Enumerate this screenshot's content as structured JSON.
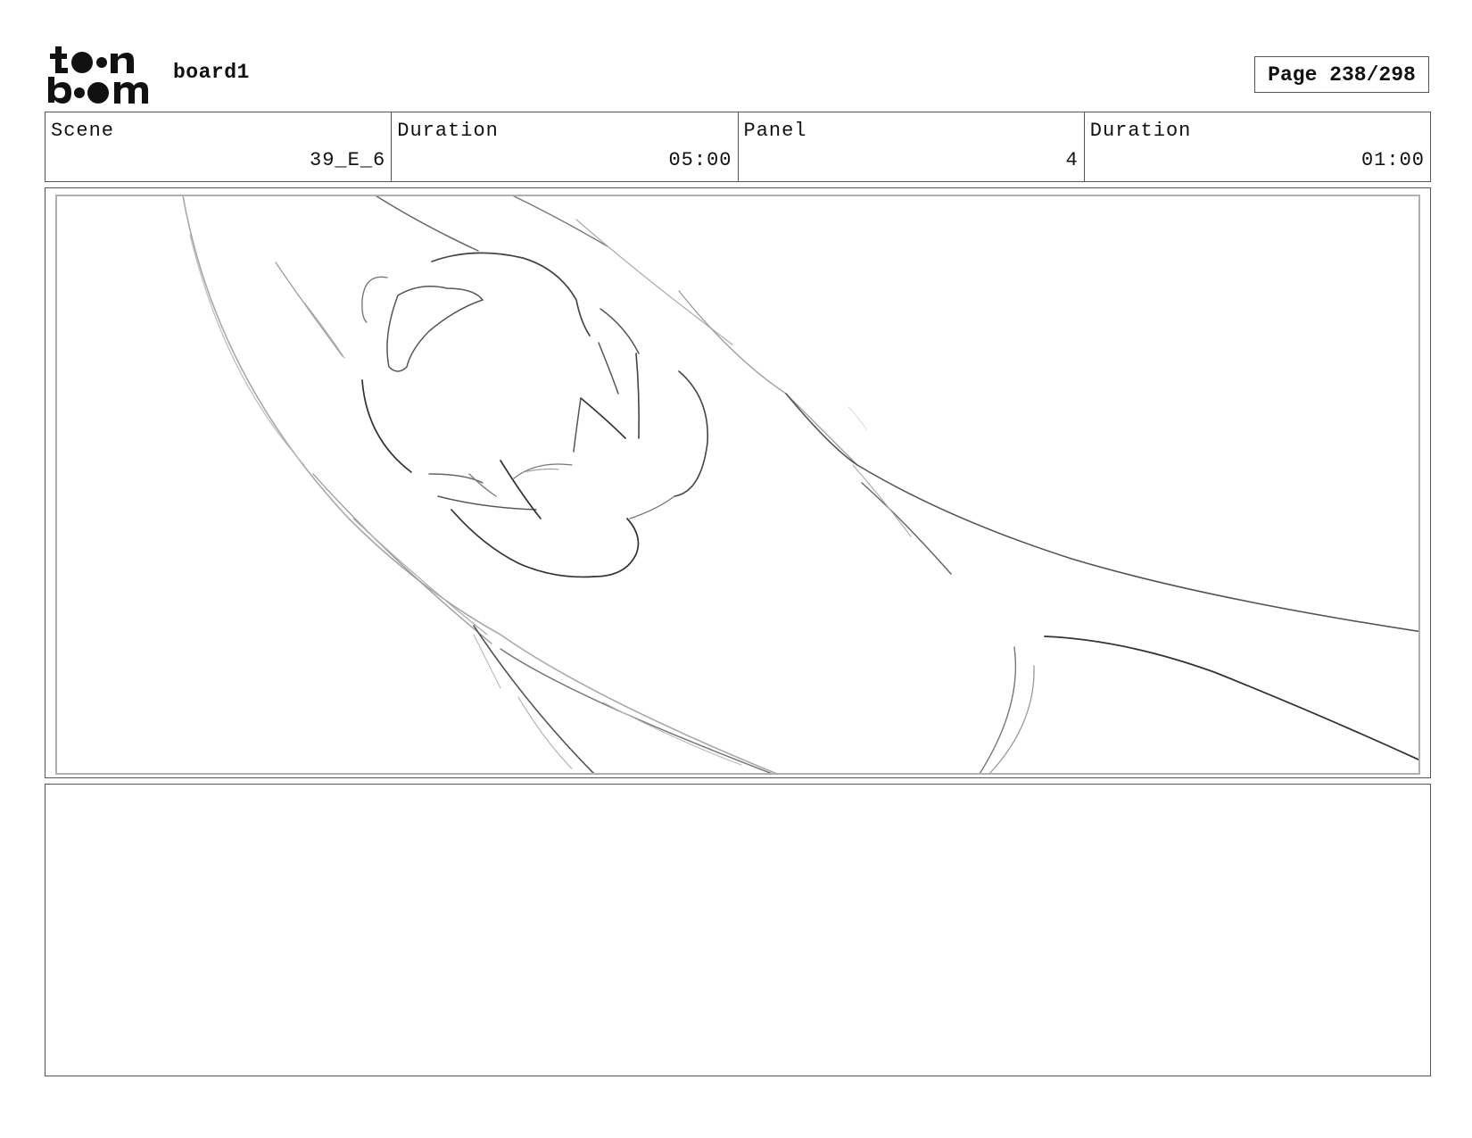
{
  "header": {
    "logo_text": "toon boom",
    "project_name": "board1",
    "page_label": "Page 238/298"
  },
  "info": {
    "scene_label": "Scene",
    "scene_value": "39_E_6",
    "scene_duration_label": "Duration",
    "scene_duration_value": "05:00",
    "panel_label": "Panel",
    "panel_value": "4",
    "panel_duration_label": "Duration",
    "panel_duration_value": "01:00"
  },
  "panel_image": {
    "icon": "rough-sketch-drawing"
  },
  "notes": {
    "text": ""
  }
}
